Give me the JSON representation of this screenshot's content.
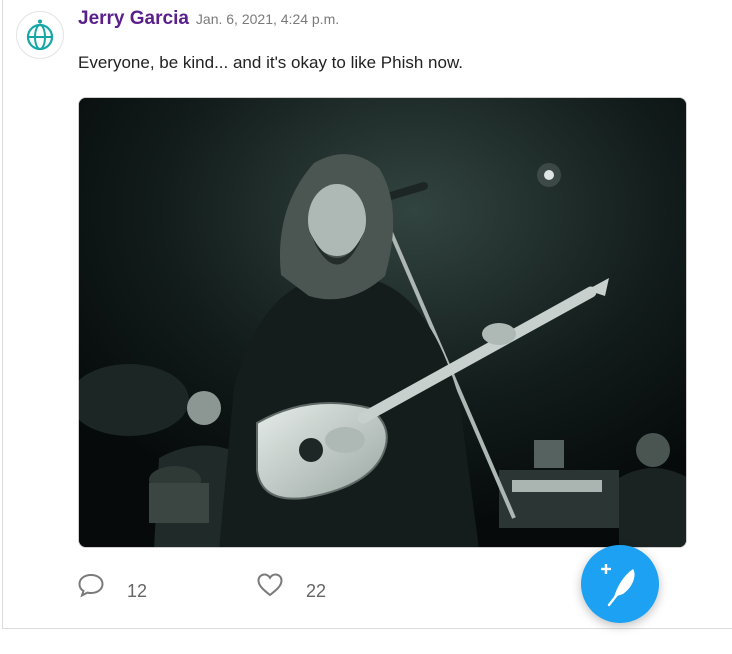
{
  "post": {
    "author": "Jerry Garcia",
    "timestamp": "Jan. 6, 2021, 4:24 p.m.",
    "body": "Everyone, be kind... and it's okay to like Phish now.",
    "replies": "12",
    "likes": "22"
  },
  "icons": {
    "avatar": "globe-icon",
    "reply": "comment-icon",
    "like": "heart-icon",
    "compose": "feather-plus-icon"
  },
  "colors": {
    "author": "#5b1f8a",
    "accent": "#1da1f2",
    "avatar_globe": "#17a6a6"
  }
}
